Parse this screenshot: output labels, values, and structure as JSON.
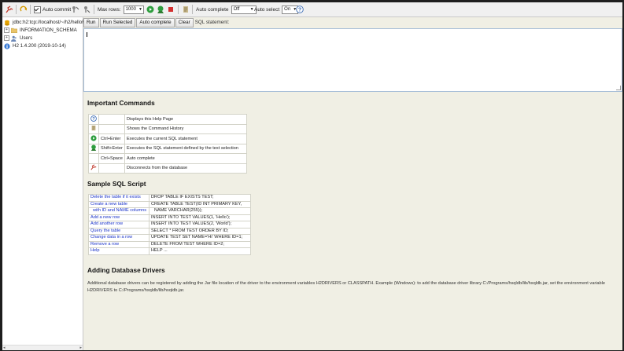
{
  "toolbar": {
    "auto_commit_label": "Auto commit",
    "auto_commit_checked": true,
    "max_rows_label": "Max rows:",
    "max_rows_value": "1000",
    "auto_complete_label": "Auto complete",
    "auto_complete_value": "Off",
    "auto_select_label": "Auto select",
    "auto_select_value": "On",
    "help_symbol": "?"
  },
  "tree": {
    "connection": "jdbc:h2:tcp://localhost/~/h2/helloF",
    "items": [
      {
        "label": "INFORMATION_SCHEMA",
        "expander": "+",
        "icon": "folder-icon"
      },
      {
        "label": "Users",
        "expander": "+",
        "icon": "users-icon"
      }
    ],
    "version": "H2 1.4.200 (2019-10-14)"
  },
  "actions": {
    "run": "Run",
    "run_selected": "Run Selected",
    "auto_complete": "Auto complete",
    "clear": "Clear",
    "sql_statement_label": "SQL statement:"
  },
  "editor": {
    "value": ""
  },
  "help": {
    "important_title": "Important Commands",
    "commands": [
      {
        "icon": "help-icon",
        "key": "",
        "desc": "Displays this Help Page"
      },
      {
        "icon": "history-icon",
        "key": "",
        "desc": "Shows the Command History"
      },
      {
        "icon": "run-icon",
        "key": "Ctrl+Enter",
        "desc": "Executes the current SQL statement"
      },
      {
        "icon": "run-selected-icon",
        "key": "Shift+Enter",
        "desc": "Executes the SQL statement defined by the text selection"
      },
      {
        "icon": "",
        "key": "Ctrl+Space",
        "desc": "Auto complete"
      },
      {
        "icon": "disconnect-icon",
        "key": "",
        "desc": "Disconnects from the database"
      }
    ],
    "sample_title": "Sample SQL Script",
    "script": [
      {
        "link": "Delete the table if it exists",
        "sql": "DROP TABLE IF EXISTS TEST;"
      },
      {
        "link": "Create a new table",
        "sql": "CREATE TABLE TEST(ID INT PRIMARY KEY,"
      },
      {
        "link": "with ID and NAME columns",
        "sql": "NAME VARCHAR(255));",
        "indent": true
      },
      {
        "link": "Add a new row",
        "sql": "INSERT INTO TEST VALUES(1, 'Hello');"
      },
      {
        "link": "Add another row",
        "sql": "INSERT INTO TEST VALUES(2, 'World');"
      },
      {
        "link": "Query the table",
        "sql": "SELECT * FROM TEST ORDER BY ID;"
      },
      {
        "link": "Change data in a row",
        "sql": "UPDATE TEST SET NAME='Hi' WHERE ID=1;"
      },
      {
        "link": "Remove a row",
        "sql": "DELETE FROM TEST WHERE ID=2;"
      },
      {
        "link": "Help",
        "sql": "HELP ..."
      }
    ],
    "drivers_title": "Adding Database Drivers",
    "drivers_text": "Additional database drivers can be registered by adding the Jar file location of the driver to the environment variables H2DRIVERS or CLASSPATH. Example (Windows): to add the database driver library C:/Programs/hsqldb/lib/hsqldb.jar, set the environment variable H2DRIVERS to C:/Programs/hsqldb/lib/hsqldb.jar."
  }
}
